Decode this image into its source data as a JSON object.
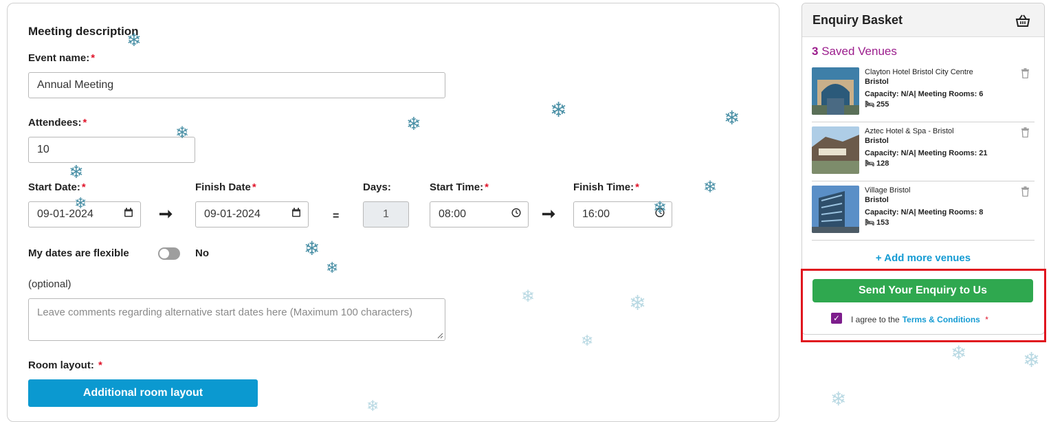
{
  "form": {
    "section_title": "Meeting description",
    "event_name_label": "Event name:",
    "event_name_value": "Annual Meeting",
    "attendees_label": "Attendees:",
    "attendees_value": "10",
    "start_date_label": "Start Date:",
    "start_date_value": "09-01-2024",
    "finish_date_label": "Finish Date",
    "finish_date_value": "09-01-2024",
    "equals": "=",
    "days_label": "Days:",
    "days_value": "1",
    "start_time_label": "Start Time:",
    "start_time_value": "08:00",
    "finish_time_label": "Finish Time:",
    "finish_time_value": "16:00",
    "flexible_label": "My dates are flexible",
    "flexible_value": "No",
    "optional_label": "(optional)",
    "comments_placeholder": "Leave comments regarding alternative start dates here (Maximum 100 characters)",
    "room_layout_label": "Room layout:",
    "additional_layout_button": "Additional room layout",
    "required_mark": "*"
  },
  "basket": {
    "title": "Enquiry Basket",
    "saved_count": "3",
    "saved_label": "Saved Venues",
    "venues": [
      {
        "name": "Clayton Hotel Bristol City Centre",
        "city": "Bristol",
        "capacity": "Capacity: N/A",
        "meeting_rooms": "Meeting Rooms: 6",
        "bedrooms": "255"
      },
      {
        "name": "Aztec Hotel & Spa - Bristol",
        "city": "Bristol",
        "capacity": "Capacity: N/A",
        "meeting_rooms": "Meeting Rooms: 21",
        "bedrooms": "128"
      },
      {
        "name": "Village Bristol",
        "city": "Bristol",
        "capacity": "Capacity: N/A",
        "meeting_rooms": "Meeting Rooms: 8",
        "bedrooms": "153"
      }
    ],
    "add_more": "+ Add more venues",
    "send_button": "Send Your Enquiry to Us",
    "agree_text": "I agree to the",
    "terms_link": "Terms & Conditions",
    "required_mark": "*"
  },
  "colors": {
    "accent_blue": "#0b99d0",
    "send_green": "#2fa84f",
    "saved_purple": "#9b1c8c",
    "highlight_red": "#e0141e"
  }
}
